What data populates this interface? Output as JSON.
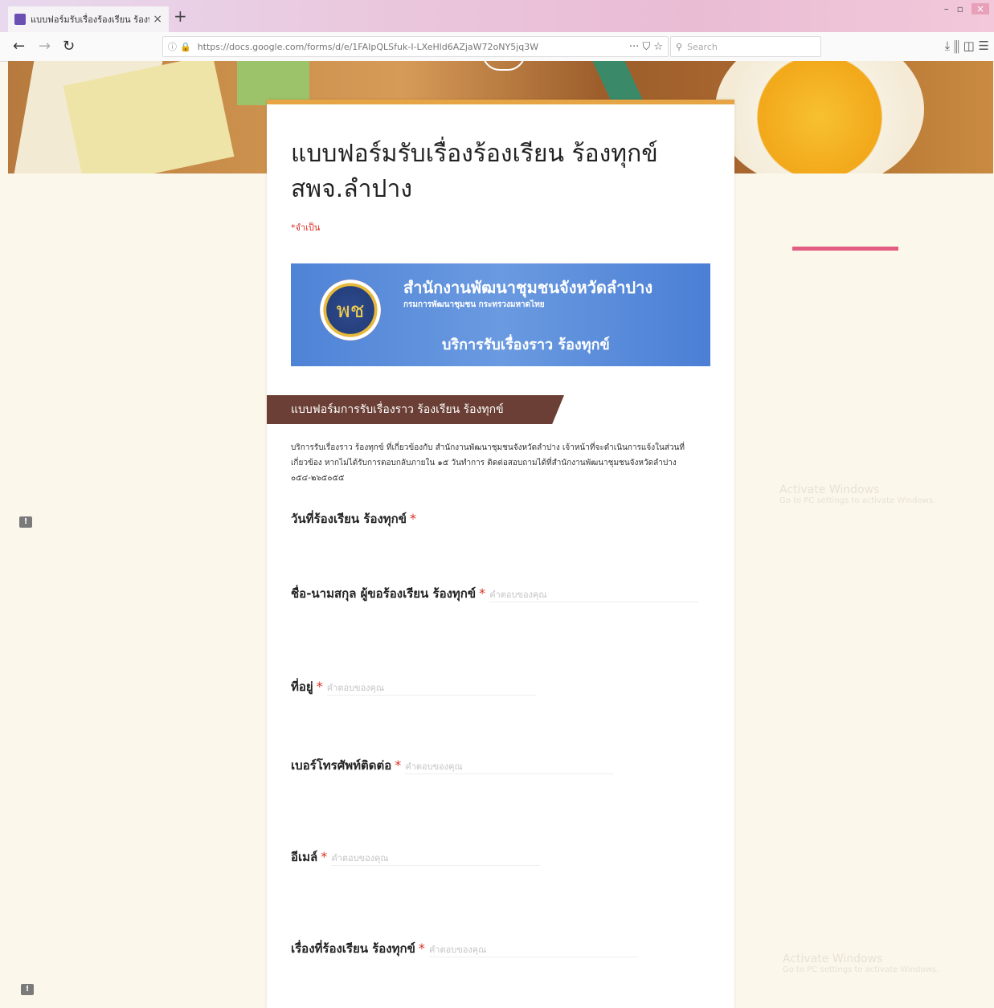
{
  "browser": {
    "tab_title": "แบบฟอร์มรับเรื่องร้องเรียน ร้องท",
    "tab_close": "×",
    "new_tab": "+",
    "url": "https://docs.google.com/forms/d/e/1FAIpQLSfuk-I-LXeHld6AZjaW72oNY5jq3W",
    "search_placeholder": "Search",
    "url_actions": "··· ⛉ ☆",
    "toolbar_icons": "⤓  ⫼  ◫  ☰",
    "window_controls": [
      "–",
      "▫",
      "×"
    ]
  },
  "form": {
    "title": "แบบฟอร์มรับเรื่องร้องเรียน ร้องทุกข์ สพจ.ลำปาง",
    "required_note": "*จำเป็น",
    "logo": {
      "title": "สำนักงานพัฒนาชุมชนจังหวัดลำปาง",
      "subtitle": "กรมการพัฒนาชุมชน กระทรวงมหาดไทย",
      "service": "บริการรับเรื่องราว ร้องทุกข์",
      "emblem_text": "พช"
    },
    "section_title": "แบบฟอร์มการรับเรื่องราว ร้องเรียน ร้องทุกข์",
    "section_description": "บริการรับเรื่องราว ร้องทุกข์ ที่เกี่ยวข้องกับ สำนักงานพัฒนาชุมชนจังหวัดลำปาง เจ้าหน้าที่จะดำเนินการแจ้งในส่วนที่เกี่ยวข้อง หากไม่ได้รับการตอบกลับภายใน ๑๕ วันทำการ ติดต่อสอบถามได้ที่สำนักงานพัฒนาชุมชนจังหวัดลำปาง ๐๕๔-๒๖๕๐๕๕",
    "questions": [
      {
        "label": "วันที่ร้องเรียน ร้องทุกข์",
        "required_mark": "*",
        "placeholder": ""
      },
      {
        "label": "ชื่อ-นามสกุล ผู้ขอร้องเรียน ร้องทุกข์",
        "required_mark": "*",
        "placeholder": "คำตอบของคุณ"
      },
      {
        "label": "ที่อยู่",
        "required_mark": "*",
        "placeholder": "คำตอบของคุณ"
      },
      {
        "label": "เบอร์โทรศัพท์ติดต่อ",
        "required_mark": "*",
        "placeholder": "คำตอบของคุณ"
      },
      {
        "label": "อีเมล์",
        "required_mark": "*",
        "placeholder": "คำตอบของคุณ"
      },
      {
        "label": "เรื่องที่ร้องเรียน ร้องทุกข์",
        "required_mark": "*",
        "placeholder": "คำตอบของคุณ"
      }
    ]
  },
  "watermark": {
    "title": "Activate Windows",
    "subtitle": "Go to PC settings to activate Windows."
  },
  "colors": {
    "accent_top": "#e6a445",
    "section_header": "#6b3f35",
    "required": "#d93025",
    "pink_bar": "#e35d82"
  }
}
